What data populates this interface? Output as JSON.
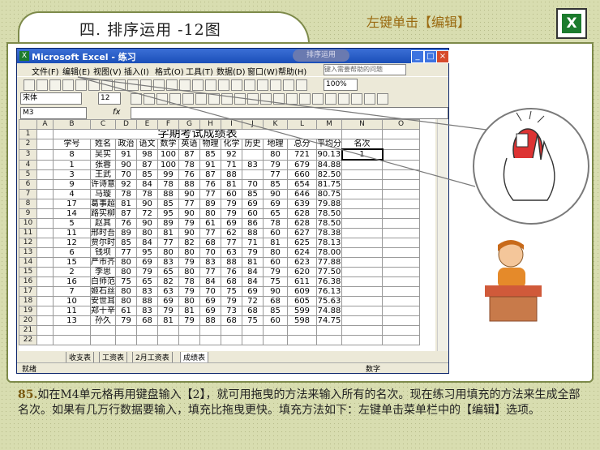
{
  "slide": {
    "title": "四. 排序运用 -12图",
    "hint": "左键单击【编辑】",
    "logo_letter": "X",
    "caption_number": "85.",
    "caption_text": "如在M4单元格再用键盘输入【2】，就可用拖曳的方法来输入所有的名次。现在练习用填充的方法来生成全部名次。如果有几万行数据要输入，填充比拖曳更快。填充方法如下：左键单击菜单栏中的【编辑】选项。"
  },
  "window": {
    "title": "Microsoft Excel - 练习",
    "badge": "排序运用",
    "menus": [
      "文件(F)",
      "编辑(E)",
      "视图(V)",
      "插入(I)",
      "格式(O)",
      "工具(T)",
      "数据(D)",
      "窗口(W)",
      "帮助(H)"
    ],
    "help_placeholder": "键入需要帮助的问题",
    "font_name": "宋体",
    "font_size": "12",
    "zoom": "100%",
    "name_box": "M3",
    "fx": "fx",
    "sheet_tabs": [
      "收支表",
      "工资表",
      "2月工资表",
      "成绩表"
    ],
    "status_left": "就绪",
    "status_right": "数字"
  },
  "sheet": {
    "col_letters": [
      "A",
      "B",
      "C",
      "D",
      "E",
      "F",
      "G",
      "H",
      "I",
      "J",
      "K",
      "L",
      "M",
      "N",
      "O"
    ],
    "title": "学期考试成绩表",
    "headers": [
      "学号",
      "姓名",
      "政治",
      "语文",
      "数学",
      "英语",
      "物理",
      "化学",
      "历史",
      "地理",
      "总分",
      "平均分",
      "名次"
    ],
    "rows": [
      [
        "8",
        "吴实",
        "91",
        "98",
        "100",
        "87",
        "85",
        "92",
        "80",
        "721",
        "90.13",
        "1"
      ],
      [
        "1",
        "张蓉",
        "90",
        "87",
        "100",
        "78",
        "91",
        "71",
        "83",
        "79",
        "679",
        "84.88",
        ""
      ],
      [
        "3",
        "王武",
        "70",
        "85",
        "99",
        "76",
        "87",
        "88",
        "77",
        "660",
        "82.50",
        ""
      ],
      [
        "9",
        "许诗意",
        "92",
        "84",
        "78",
        "88",
        "76",
        "81",
        "70",
        "85",
        "654",
        "81.75",
        ""
      ],
      [
        "4",
        "马璇",
        "78",
        "78",
        "88",
        "90",
        "77",
        "60",
        "85",
        "90",
        "646",
        "80.75",
        ""
      ],
      [
        "17",
        "葛事超",
        "81",
        "90",
        "85",
        "77",
        "89",
        "79",
        "69",
        "69",
        "639",
        "79.88",
        ""
      ],
      [
        "14",
        "路实柳",
        "87",
        "72",
        "95",
        "90",
        "80",
        "79",
        "60",
        "65",
        "628",
        "78.50",
        ""
      ],
      [
        "5",
        "赵其",
        "76",
        "90",
        "89",
        "79",
        "61",
        "69",
        "86",
        "78",
        "628",
        "78.50",
        ""
      ],
      [
        "11",
        "邢时吾",
        "89",
        "80",
        "81",
        "90",
        "77",
        "62",
        "88",
        "60",
        "627",
        "78.38",
        ""
      ],
      [
        "12",
        "贾尔时",
        "85",
        "84",
        "77",
        "82",
        "68",
        "77",
        "71",
        "81",
        "625",
        "78.13",
        ""
      ],
      [
        "6",
        "钱坝",
        "77",
        "95",
        "80",
        "80",
        "70",
        "63",
        "79",
        "80",
        "624",
        "78.00",
        ""
      ],
      [
        "15",
        "严市齐",
        "80",
        "69",
        "83",
        "79",
        "83",
        "88",
        "81",
        "60",
        "623",
        "77.88",
        ""
      ],
      [
        "2",
        "李思",
        "80",
        "79",
        "65",
        "80",
        "77",
        "76",
        "84",
        "79",
        "620",
        "77.50",
        ""
      ],
      [
        "16",
        "白师范",
        "75",
        "65",
        "82",
        "78",
        "84",
        "68",
        "84",
        "75",
        "611",
        "76.38",
        ""
      ],
      [
        "7",
        "姬石丝",
        "80",
        "83",
        "63",
        "79",
        "70",
        "75",
        "69",
        "90",
        "609",
        "76.13",
        ""
      ],
      [
        "10",
        "安世耳",
        "80",
        "88",
        "69",
        "80",
        "69",
        "79",
        "72",
        "68",
        "605",
        "75.63",
        ""
      ],
      [
        "11",
        "郑十辛",
        "61",
        "83",
        "79",
        "81",
        "69",
        "73",
        "68",
        "85",
        "599",
        "74.88",
        ""
      ],
      [
        "13",
        "孙久",
        "79",
        "68",
        "81",
        "79",
        "88",
        "68",
        "75",
        "60",
        "598",
        "74.75",
        ""
      ]
    ]
  },
  "colors": {
    "background": "#d8ddb0",
    "frame": "#7d8a4a",
    "hint_text": "#9a6a10",
    "titlebar": "#1b4fb8",
    "excel_green": "#1c7b2e"
  }
}
